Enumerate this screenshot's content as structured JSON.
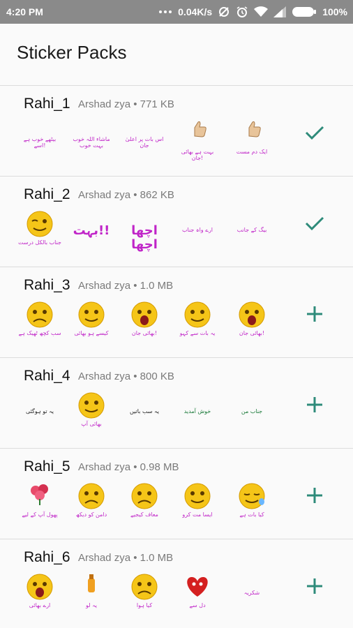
{
  "status_bar": {
    "time": "4:20 PM",
    "network_speed": "0.04K/s",
    "battery": "100%",
    "icons": [
      "dots-icon",
      "data-saver-icon",
      "alarm-icon",
      "wifi-icon",
      "signal-icon",
      "battery-icon"
    ]
  },
  "app_bar": {
    "title": "Sticker Packs"
  },
  "colors": {
    "accent": "#2e8b7a",
    "status_bar": "#8a8a8a",
    "meta_text": "#7a7a7a",
    "sticker_caption_magenta": "#c025c8",
    "emoji_yellow": "#f5c518"
  },
  "packs": [
    {
      "name": "Rahi_1",
      "author": "Arshad zya",
      "size": "771 KB",
      "action": "added",
      "action_icon": "check-icon",
      "stickers": [
        {
          "icon": "text-sticker",
          "caption": "بیٹھے خوب ہے اسے!"
        },
        {
          "icon": "text-sticker",
          "caption": "ماشاء اللہ خوب بہت خوب"
        },
        {
          "icon": "text-sticker",
          "caption": "اس بات پر اعلیٰ جان"
        },
        {
          "icon": "thumbs-up-sticker",
          "caption": "بہت ہے بھائی جان!"
        },
        {
          "icon": "thumbs-up-sticker",
          "caption": "ایک دم مست"
        }
      ]
    },
    {
      "name": "Rahi_2",
      "author": "Arshad zya",
      "size": "862 KB",
      "action": "added",
      "action_icon": "check-icon",
      "stickers": [
        {
          "icon": "wink-emoji-sticker",
          "caption": "جناب بالکل درست"
        },
        {
          "icon": "text-sticker",
          "caption": "بہت!!"
        },
        {
          "icon": "text-sticker",
          "caption": "اچھا اچھا"
        },
        {
          "icon": "text-sticker",
          "caption": "ارے واہ جناب"
        },
        {
          "icon": "text-sticker",
          "caption": "بیگ کے جانب"
        }
      ]
    },
    {
      "name": "Rahi_3",
      "author": "Arshad zya",
      "size": "1.0 MB",
      "action": "add",
      "action_icon": "plus-icon",
      "stickers": [
        {
          "icon": "sad-emoji-sticker",
          "caption": "سب کچھ ٹھیک ہے"
        },
        {
          "icon": "wave-emoji-sticker",
          "caption": "کیسے ہو بھائی"
        },
        {
          "icon": "shocked-emoji-sticker",
          "caption": "بھائی جان!"
        },
        {
          "icon": "pointing-emoji-sticker",
          "caption": "یہ بات سے کہو"
        },
        {
          "icon": "shouting-emoji-sticker",
          "caption": "بھائی جان!"
        }
      ]
    },
    {
      "name": "Rahi_4",
      "author": "Arshad zya",
      "size": "800 KB",
      "action": "add",
      "action_icon": "plus-icon",
      "stickers": [
        {
          "icon": "text-sticker",
          "caption": "یہ تو ہوگئی"
        },
        {
          "icon": "emoji-text-sticker",
          "caption": "بھائی آپ"
        },
        {
          "icon": "text-sticker",
          "caption": "یہ سب باتیں"
        },
        {
          "icon": "text-sticker",
          "caption": "خوش آمدید"
        },
        {
          "icon": "text-sticker",
          "caption": "جناب من"
        }
      ]
    },
    {
      "name": "Rahi_5",
      "author": "Arshad zya",
      "size": "0.98 MB",
      "action": "add",
      "action_icon": "plus-icon",
      "stickers": [
        {
          "icon": "flower-sticker",
          "caption": "پھول آپ کے لیے"
        },
        {
          "icon": "crying-emoji-sticker",
          "caption": "دامن کو دیکھ"
        },
        {
          "icon": "sad-emoji-sticker",
          "caption": "معاف کیجیے"
        },
        {
          "icon": "thinking-emoji-sticker",
          "caption": "ایسا مت کرو"
        },
        {
          "icon": "sleepy-emoji-sticker",
          "caption": "کیا بات ہے"
        }
      ]
    },
    {
      "name": "Rahi_6",
      "author": "Arshad zya",
      "size": "1.0 MB",
      "action": "add",
      "action_icon": "plus-icon",
      "stickers": [
        {
          "icon": "shouting-emoji-sticker",
          "caption": "ارے بھائی"
        },
        {
          "icon": "bottle-sticker",
          "caption": "یہ لو"
        },
        {
          "icon": "worried-emoji-sticker",
          "caption": "کیا ہوا"
        },
        {
          "icon": "heart-sticker",
          "caption": "دل سے"
        },
        {
          "icon": "text-sticker",
          "caption": "شکریہ"
        }
      ]
    }
  ]
}
